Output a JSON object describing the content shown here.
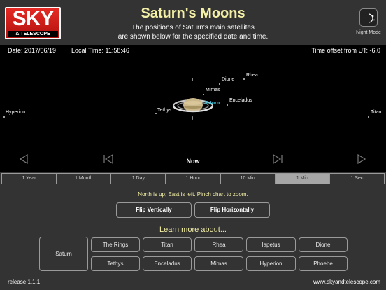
{
  "header": {
    "logo_top": "SKY",
    "logo_bottom": "& TELESCOPE",
    "title": "Saturn's Moons",
    "subtitle_line1": "The positions of Saturn's main satellites",
    "subtitle_line2": "are shown below for the specified date and time.",
    "night_mode_label": "Night Mode"
  },
  "info": {
    "date": "Date: 2017/06/19",
    "local_time": "Local Time: 11:58:46",
    "ut_offset": "Time offset from UT: -6.0"
  },
  "moons": {
    "hyperion": "Hyperion",
    "tethys": "Tethys",
    "mimas": "Mimas",
    "dione": "Dione",
    "rhea": "Rhea",
    "enceladus": "Enceladus",
    "saturn": "Saturn",
    "titan": "Titan"
  },
  "nav": {
    "now_label": "Now"
  },
  "time_steps": [
    "1 Year",
    "1 Month",
    "1 Day",
    "1 Hour",
    "10 Min",
    "1 Min",
    "1 Sec"
  ],
  "active_step": "1 Min",
  "hint": "North is up; East is left. Pinch chart to zoom.",
  "flip": {
    "vertical": "Flip Vertically",
    "horizontal": "Flip Horizontally"
  },
  "learn_more": {
    "heading": "Learn more about...",
    "saturn": "Saturn",
    "row1": [
      "The Rings",
      "Titan",
      "Rhea",
      "Iapetus",
      "Dione"
    ],
    "row2": [
      "Tethys",
      "Enceladus",
      "Mimas",
      "Hyperion",
      "Phoebe"
    ]
  },
  "footer": {
    "release": "release 1.1.1",
    "website": "www.skyandtelescope.com"
  },
  "colors": {
    "accent_yellow": "#f3efa6",
    "saturn_label": "#3fc8e0",
    "logo_red": "#d8201c"
  }
}
